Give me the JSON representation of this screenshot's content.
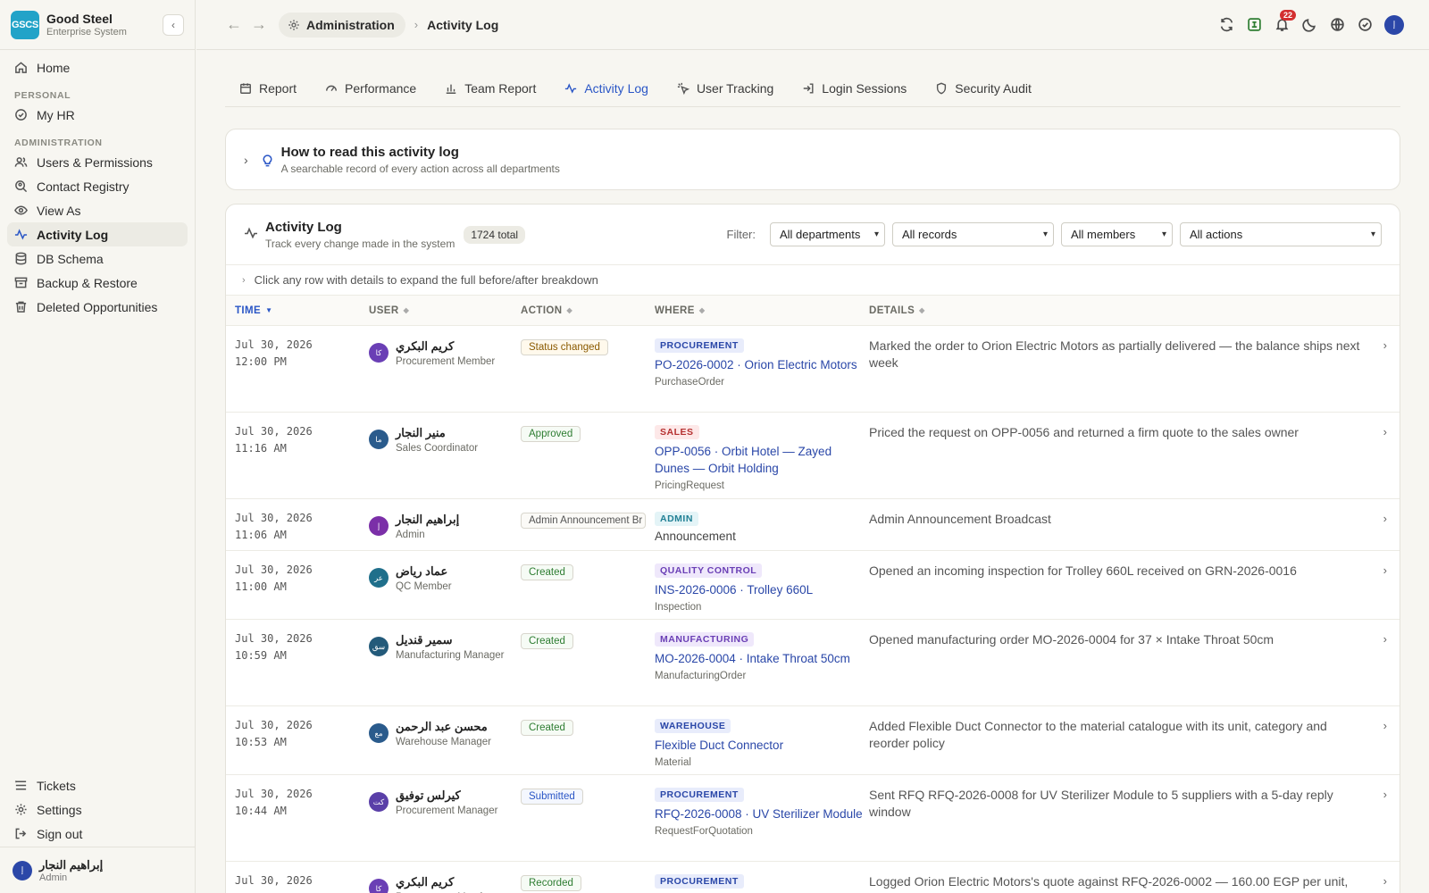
{
  "brand": {
    "logo": "GSCS",
    "name": "Good Steel",
    "subtitle": "Enterprise System"
  },
  "sidebar": {
    "home": "Home",
    "personal_label": "PERSONAL",
    "my_hr": "My HR",
    "admin_label": "ADMINISTRATION",
    "admin_items": [
      {
        "label": "Users & Permissions",
        "icon": "users-icon"
      },
      {
        "label": "Contact Registry",
        "icon": "contact-search-icon"
      },
      {
        "label": "View As",
        "icon": "eye-icon"
      },
      {
        "label": "Activity Log",
        "icon": "activity-icon",
        "active": true
      },
      {
        "label": "DB Schema",
        "icon": "database-icon"
      },
      {
        "label": "Backup & Restore",
        "icon": "archive-icon"
      },
      {
        "label": "Deleted Opportunities",
        "icon": "trash-icon"
      }
    ],
    "bottom": {
      "tickets": "Tickets",
      "settings": "Settings",
      "sign_out": "Sign out"
    },
    "user": {
      "initials": "إ",
      "name": "إبراهيم النجار",
      "role": "Admin"
    }
  },
  "topbar": {
    "crumb_parent": "Administration",
    "crumb_current": "Activity Log",
    "notification_count": "22",
    "avatar_initials": "إ"
  },
  "tabs": [
    {
      "label": "Report",
      "icon": "calendar-icon"
    },
    {
      "label": "Performance",
      "icon": "gauge-icon"
    },
    {
      "label": "Team Report",
      "icon": "bar-chart-icon"
    },
    {
      "label": "Activity Log",
      "icon": "activity-icon",
      "active": true
    },
    {
      "label": "User Tracking",
      "icon": "cursor-click-icon"
    },
    {
      "label": "Login Sessions",
      "icon": "login-icon"
    },
    {
      "label": "Security Audit",
      "icon": "shield-icon"
    }
  ],
  "help": {
    "title": "How to read this activity log",
    "subtitle": "A searchable record of every action across all departments"
  },
  "log": {
    "title": "Activity Log",
    "subtitle": "Track every change made in the system",
    "total": "1724 total",
    "filter_label": "Filter:",
    "filters": {
      "departments": "All departments",
      "records": "All records",
      "members": "All members",
      "actions": "All actions"
    },
    "hint": "Click any row with details to expand the full before/after breakdown",
    "columns": {
      "time": "TIME",
      "user": "USER",
      "action": "ACTION",
      "where": "WHERE",
      "details": "DETAILS"
    },
    "rows": [
      {
        "date": "Jul 30, 2026",
        "time": "12:00 PM",
        "user_initials": "كا",
        "user_name": "كريم البكري",
        "user_role": "Procurement Member",
        "avatar_color": "#6a3fb5",
        "action": "Status changed",
        "action_style": "amber",
        "dept": "PROCUREMENT",
        "dept_style": "blue",
        "record": "PO-2026-0002 · Orion Electric Motors",
        "record_type": "PurchaseOrder",
        "details": "Marked the order to Orion Electric Motors as partially delivered — the balance ships next week"
      },
      {
        "date": "Jul 30, 2026",
        "time": "11:16 AM",
        "user_initials": "ما",
        "user_name": "منير النجار",
        "user_role": "Sales Coordinator",
        "avatar_color": "#2a5b8c",
        "action": "Approved",
        "action_style": "green",
        "dept": "SALES",
        "dept_style": "red",
        "record": "OPP-0056 · Orbit Hotel — Zayed Dunes — Orbit Holding",
        "record_type": "PricingRequest",
        "details": "Priced the request on OPP-0056 and returned a firm quote to the sales owner"
      },
      {
        "date": "Jul 30, 2026",
        "time": "11:06 AM",
        "user_initials": "إ",
        "user_name": "إبراهيم النجار",
        "user_role": "Admin",
        "avatar_color": "#7b2fa8",
        "action": "Admin Announcement Br",
        "action_style": "gray",
        "dept": "ADMIN",
        "dept_style": "teal",
        "record": "",
        "record_type": "",
        "record_plain": "Announcement",
        "details": "Admin Announcement Broadcast"
      },
      {
        "date": "Jul 30, 2026",
        "time": "11:00 AM",
        "user_initials": "عر",
        "user_name": "عماد رياض",
        "user_role": "QC Member",
        "avatar_color": "#1f6f8b",
        "action": "Created",
        "action_style": "green",
        "dept": "QUALITY CONTROL",
        "dept_style": "purple",
        "record": "INS-2026-0006 · Trolley 660L",
        "record_type": "Inspection",
        "details": "Opened an incoming inspection for Trolley 660L received on GRN-2026-0016"
      },
      {
        "date": "Jul 30, 2026",
        "time": "10:59 AM",
        "user_initials": "سق",
        "user_name": "سمير قنديل",
        "user_role": "Manufacturing Manager",
        "avatar_color": "#235a7a",
        "action": "Created",
        "action_style": "green",
        "dept": "MANUFACTURING",
        "dept_style": "purple",
        "record": "MO-2026-0004 · Intake Throat 50cm",
        "record_type": "ManufacturingOrder",
        "details": "Opened manufacturing order MO-2026-0004 for 37 × Intake Throat 50cm"
      },
      {
        "date": "Jul 30, 2026",
        "time": "10:53 AM",
        "user_initials": "مع",
        "user_name": "محسن عبد الرحمن",
        "user_role": "Warehouse Manager",
        "avatar_color": "#2a5b8c",
        "action": "Created",
        "action_style": "green",
        "dept": "WAREHOUSE",
        "dept_style": "blue",
        "record": "Flexible Duct Connector",
        "record_type": "Material",
        "details": "Added Flexible Duct Connector to the material catalogue with its unit, category and reorder policy"
      },
      {
        "date": "Jul 30, 2026",
        "time": "10:44 AM",
        "user_initials": "كت",
        "user_name": "كيرلس توفيق",
        "user_role": "Procurement Manager",
        "avatar_color": "#5a3fa8",
        "action": "Submitted",
        "action_style": "blue",
        "dept": "PROCUREMENT",
        "dept_style": "blue",
        "record": "RFQ-2026-0008 · UV Sterilizer Module",
        "record_type": "RequestForQuotation",
        "details": "Sent RFQ RFQ-2026-0008 for UV Sterilizer Module to 5 suppliers with a 5-day reply window"
      },
      {
        "date": "Jul 30, 2026",
        "time": "",
        "user_initials": "كا",
        "user_name": "كريم البكري",
        "user_role": "Procurement Member",
        "avatar_color": "#6a3fb5",
        "action": "Recorded",
        "action_style": "green",
        "dept": "PROCUREMENT",
        "dept_style": "blue",
        "record": "",
        "record_type": "",
        "details": "Logged Orion Electric Motors's quote against RFQ-2026-0002 — 160.00 EGP per unit,"
      }
    ]
  }
}
